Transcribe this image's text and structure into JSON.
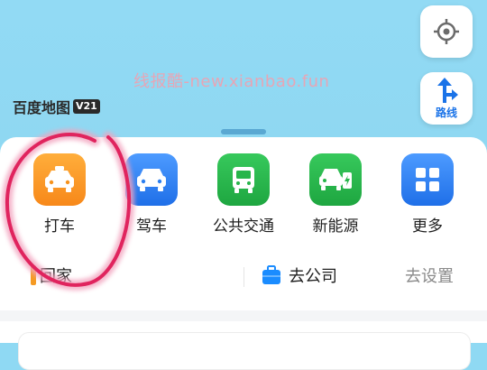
{
  "map": {
    "watermark": "线报酷-new.xianbao.fun",
    "logo_text": "百度地图",
    "logo_badge": "V21"
  },
  "map_controls": {
    "locate_icon": "crosshair-icon",
    "route_label": "路线",
    "route_icon": "route-arrow-icon"
  },
  "features": [
    {
      "label": "打车",
      "icon": "taxi-icon",
      "color": "#f7931e"
    },
    {
      "label": "驾车",
      "icon": "car-icon",
      "color": "#2b7ff0"
    },
    {
      "label": "公共交通",
      "icon": "bus-icon",
      "color": "#27b54a"
    },
    {
      "label": "新能源",
      "icon": "ev-car-icon",
      "color": "#27b54a"
    },
    {
      "label": "更多",
      "icon": "grid-icon",
      "color": "#2b7ff0"
    }
  ],
  "quick": {
    "home_label": "回家",
    "company_label": "去公司",
    "settings_label": "去设置"
  },
  "colors": {
    "map_bg": "#8fd9f3",
    "annotation": "#e0245e"
  }
}
